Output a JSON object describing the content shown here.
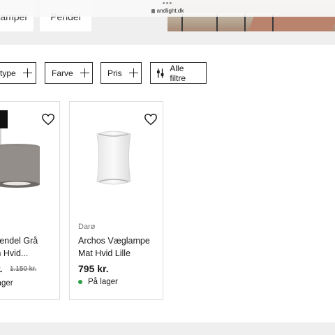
{
  "browser": {
    "url": "andlight.dk",
    "menu_dots": "•••"
  },
  "categories": [
    {
      "label": "Lamper"
    },
    {
      "label": "Pendel"
    }
  ],
  "filters": [
    {
      "label": "type"
    },
    {
      "label": "Farve"
    },
    {
      "label": "Pris"
    },
    {
      "label": "Alle filtre"
    }
  ],
  "products": [
    {
      "brand": "",
      "name_line1": "Pendel Grå",
      "name_line2": "m Hvid...",
      "price": "r.",
      "old_price": "1.150 kr.",
      "stock": "lager",
      "stock_color": "#2e9e46"
    },
    {
      "brand": "Darø",
      "name_line1": "Archos Væglampe",
      "name_line2": "Mat Hvid Lille",
      "price": "795 kr.",
      "old_price": "",
      "stock": "På lager",
      "stock_color": "#2e9e46"
    }
  ],
  "icons": {
    "favorite": "heart-outline-icon",
    "add": "plus-icon",
    "filters": "sliders-icon"
  }
}
